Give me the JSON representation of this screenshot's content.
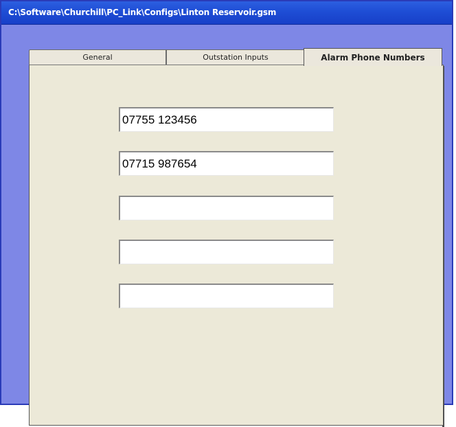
{
  "window": {
    "title": "C:\\Software\\Churchill\\PC_Link\\Configs\\Linton Reservoir.gsm"
  },
  "tabs": [
    {
      "label": "General",
      "selected": false
    },
    {
      "label": "Outstation Inputs",
      "selected": false
    },
    {
      "label": "Alarm Phone Numbers",
      "selected": true
    }
  ],
  "alarm_phone_numbers": [
    {
      "value": "07755 123456"
    },
    {
      "value": "07715 987654"
    },
    {
      "value": ""
    },
    {
      "value": ""
    },
    {
      "value": ""
    }
  ],
  "colors": {
    "titlebar": "#1f4fd6",
    "client_background": "#7e87e6",
    "panel_background": "#ece9d8"
  }
}
